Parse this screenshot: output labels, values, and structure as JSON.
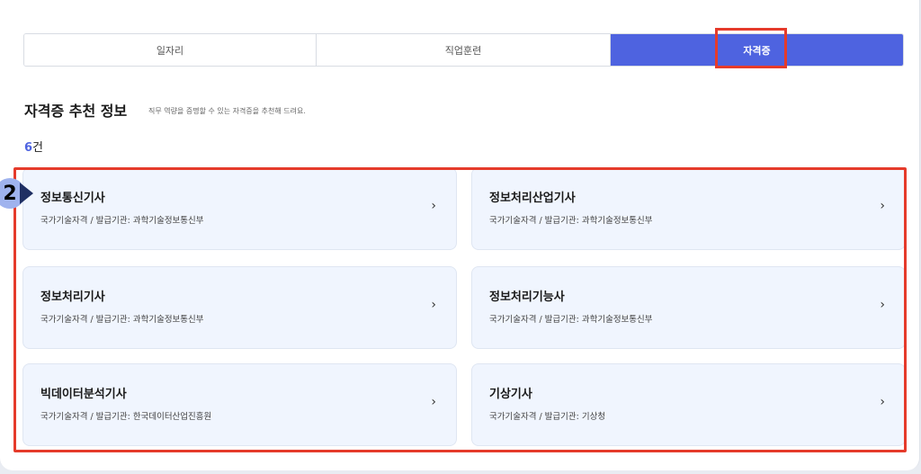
{
  "tabs": [
    {
      "label": "일자리"
    },
    {
      "label": "직업훈련"
    },
    {
      "label": "자격증",
      "active": true
    }
  ],
  "section": {
    "title": "자격증 추천 정보",
    "description": "직무 역량을 증명할 수 있는 자격증을 추천해 드려요.",
    "count_value": "6",
    "count_unit": "건"
  },
  "step_badge": "2",
  "chevron": "›",
  "cards": [
    {
      "title": "정보통신기사",
      "subtitle": "국가기술자격 / 발급기관: 과학기술정보통신부"
    },
    {
      "title": "정보처리산업기사",
      "subtitle": "국가기술자격 / 발급기관: 과학기술정보통신부"
    },
    {
      "title": "정보처리기사",
      "subtitle": "국가기술자격 / 발급기관: 과학기술정보통신부"
    },
    {
      "title": "정보처리기능사",
      "subtitle": "국가기술자격 / 발급기관: 과학기술정보통신부"
    },
    {
      "title": "빅데이터분석기사",
      "subtitle": "국가기술자격 / 발급기관: 한국데이터산업진흥원"
    },
    {
      "title": "기상기사",
      "subtitle": "국가기술자격 / 발급기관: 기상청"
    }
  ],
  "colors": {
    "accent": "#4e63e0",
    "highlight": "#e53b2b",
    "card_bg": "#f0f5fe"
  }
}
